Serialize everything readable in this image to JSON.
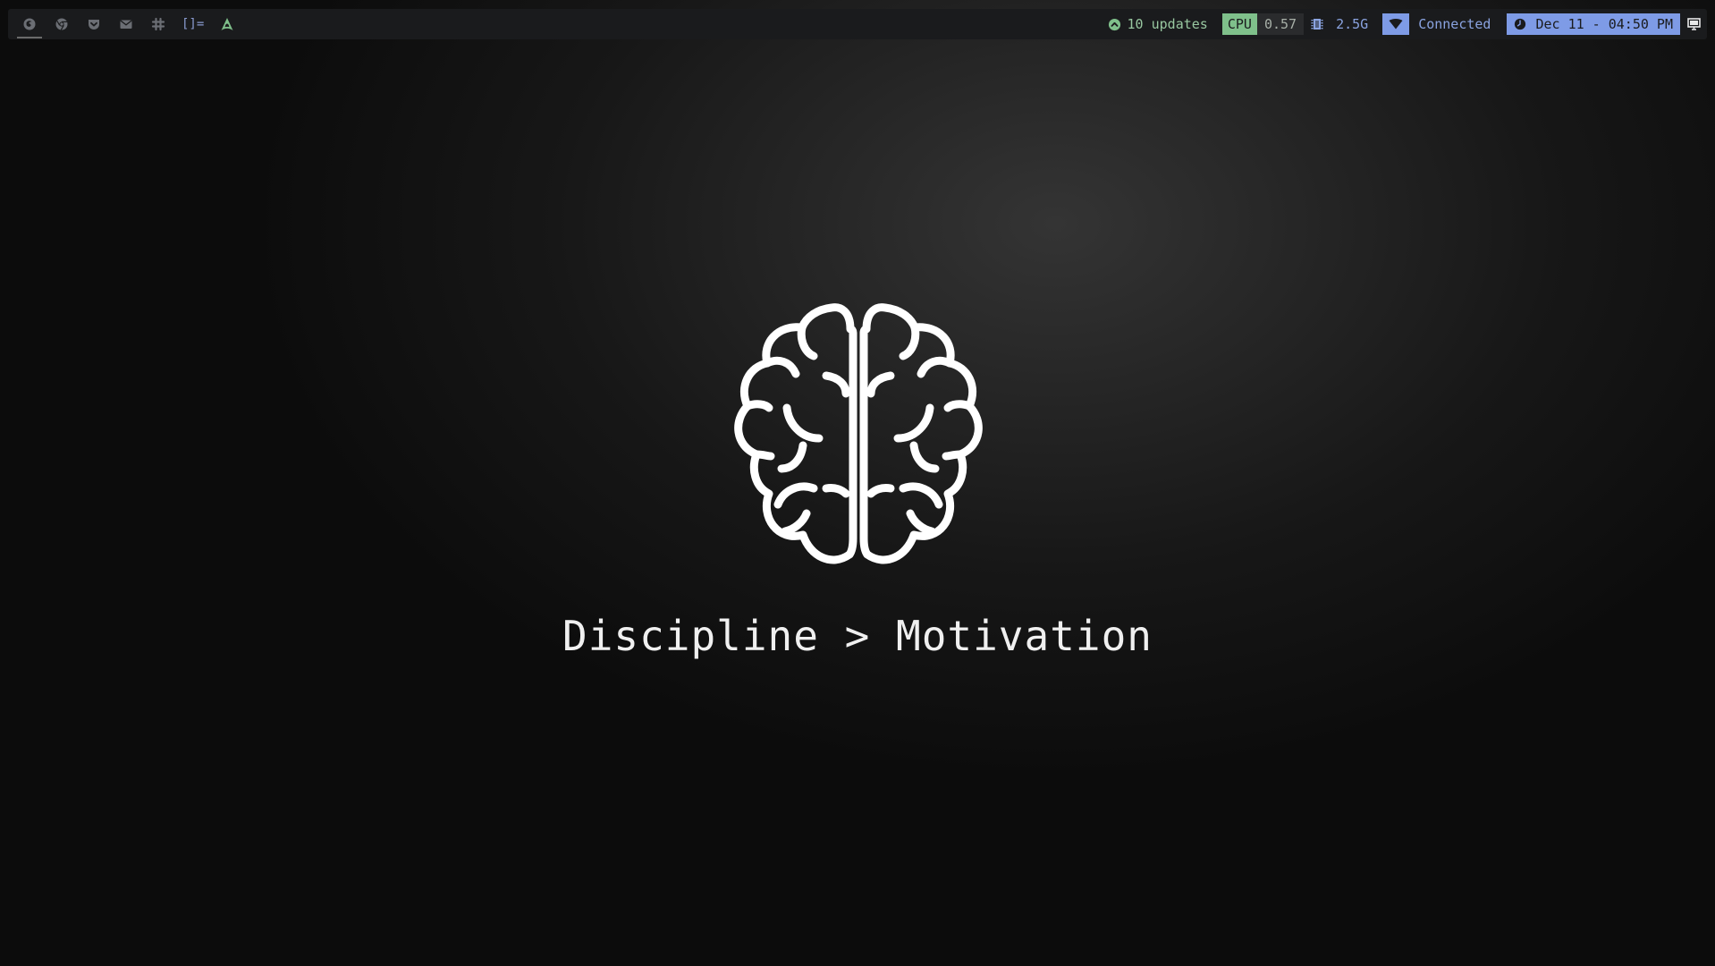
{
  "bar": {
    "workspaces": [
      {
        "icon": "firefox-icon",
        "active": true
      },
      {
        "icon": "chrome-icon",
        "active": false
      },
      {
        "icon": "pocket-icon",
        "active": false
      },
      {
        "icon": "mail-icon",
        "active": false
      },
      {
        "icon": "slack-icon",
        "active": false
      }
    ],
    "layout_symbol": "[]=",
    "launcher_icon": "arch-logo-icon",
    "updates_text": "10 updates",
    "cpu_label": "CPU",
    "cpu_value": "0.57",
    "mem_value": "2.5G",
    "net_status": "Connected",
    "clock_text": "Dec 11 - 04:50 PM",
    "tray_icon": "monitor-icon",
    "colors": {
      "bar_bg": "#1a1b1d",
      "green": "#7fc08b",
      "blue": "#7e9be6",
      "workspace_icon": "#6b6e74"
    }
  },
  "wallpaper": {
    "icon": "brain-icon",
    "quote": "Discipline > Motivation"
  }
}
